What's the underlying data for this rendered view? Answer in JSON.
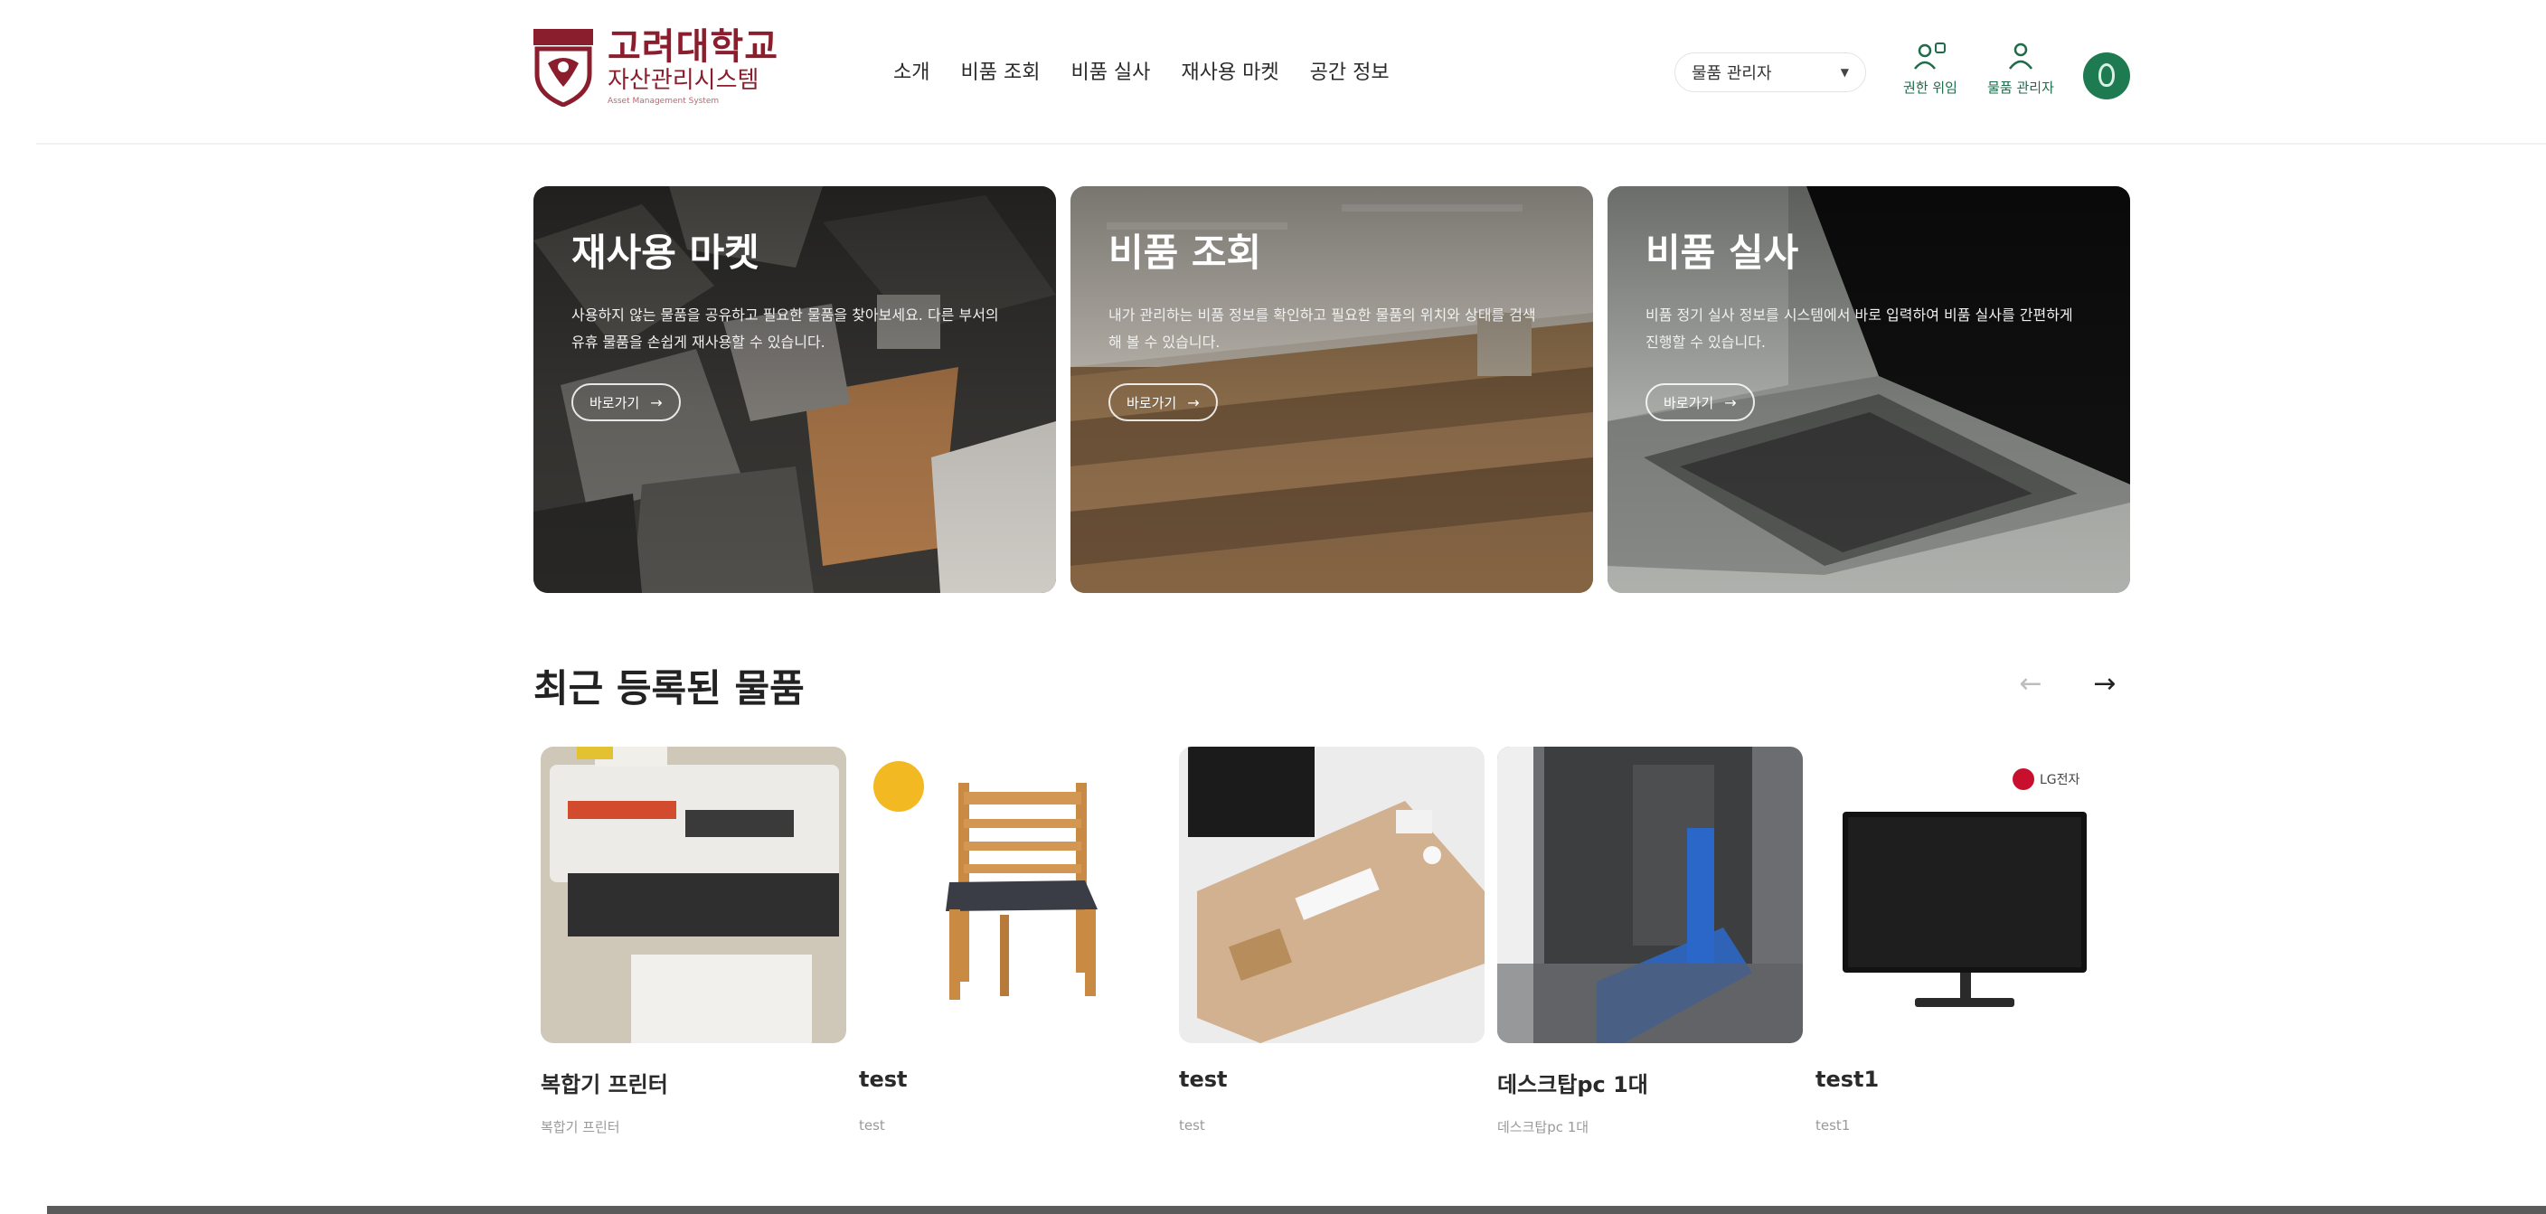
{
  "brand": {
    "title": "고려대학교",
    "subtitle": "자산관리시스템",
    "tagline": "Asset Management System",
    "color": "#8b1e2d"
  },
  "nav": [
    {
      "label": "소개"
    },
    {
      "label": "비품 조회"
    },
    {
      "label": "비품 실사"
    },
    {
      "label": "재사용 마켓"
    },
    {
      "label": "공간 정보"
    }
  ],
  "header": {
    "select_value": "물품 관리자",
    "buttons": [
      {
        "label": "권한 위임",
        "icon": "delegate-icon"
      },
      {
        "label": "물품 관리자",
        "icon": "user-icon"
      }
    ],
    "accent": "#1e7a50"
  },
  "hero_cards": [
    {
      "title": "재사용 마켓",
      "description": "사용하지 않는 물품을 공유하고 필요한 물품을 찾아보세요. 다른 부서의 유휴 물품을 손쉽게 재사용할 수 있습니다.",
      "button": "바로가기"
    },
    {
      "title": "비품 조회",
      "description": "내가 관리하는 비품 정보를 확인하고 필요한 물품의 위치와 상태를 검색해 볼 수 있습니다.",
      "button": "바로가기"
    },
    {
      "title": "비품 실사",
      "description": "비품 정기 실사 정보를 시스템에서 바로 입력하여 비품 실사를 간편하게 진행할 수 있습니다.",
      "button": "바로가기"
    }
  ],
  "recent": {
    "title": "최근 등록된 물품",
    "items": [
      {
        "name": "복합기 프린터",
        "sub": "복합기 프린터",
        "image": "printer"
      },
      {
        "name": "test",
        "sub": "test",
        "image": "chair"
      },
      {
        "name": "test",
        "sub": "test",
        "image": "desk"
      },
      {
        "name": "데스크탑pc 1대",
        "sub": "데스크탑pc 1대",
        "image": "desktop-pc"
      },
      {
        "name": "test1",
        "sub": "test1",
        "image": "monitor"
      }
    ],
    "monitor_badge": "LG전자"
  }
}
